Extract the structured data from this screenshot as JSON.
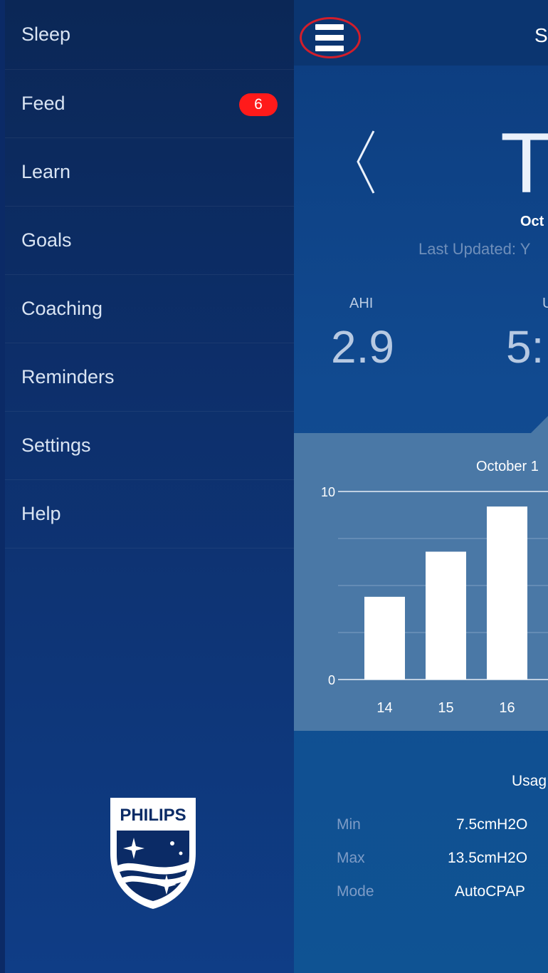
{
  "sidebar": {
    "items": [
      {
        "label": "Sleep"
      },
      {
        "label": "Feed",
        "badge": "6"
      },
      {
        "label": "Learn"
      },
      {
        "label": "Goals"
      },
      {
        "label": "Coaching"
      },
      {
        "label": "Reminders"
      },
      {
        "label": "Settings"
      },
      {
        "label": "Help"
      }
    ],
    "logo_text": "PHILIPS"
  },
  "main": {
    "topbar_title": "S",
    "day": "Tu",
    "date": "Oct",
    "last_updated": "Last Updated: Y",
    "stats": [
      {
        "label": "AHI",
        "value": "2.9"
      },
      {
        "label": "U",
        "value": "5:"
      }
    ],
    "chart_title": "October 1",
    "usage_title": "Usag",
    "settings": [
      {
        "label": "Min",
        "value": "7.5cmH2O"
      },
      {
        "label": "Max",
        "value": "13.5cmH2O"
      },
      {
        "label": "Mode",
        "value": "AutoCPAP"
      }
    ]
  },
  "colors": {
    "badge": "#ff1a1a",
    "highlight_ring": "#d21e2b",
    "chart_bg": "#4a78a6"
  },
  "chart_data": {
    "type": "bar",
    "categories": [
      "14",
      "15",
      "16"
    ],
    "values": [
      4.4,
      6.8,
      9.2
    ],
    "ylim": [
      0,
      10
    ],
    "yticks": [
      "0",
      "10"
    ],
    "grid": true
  }
}
